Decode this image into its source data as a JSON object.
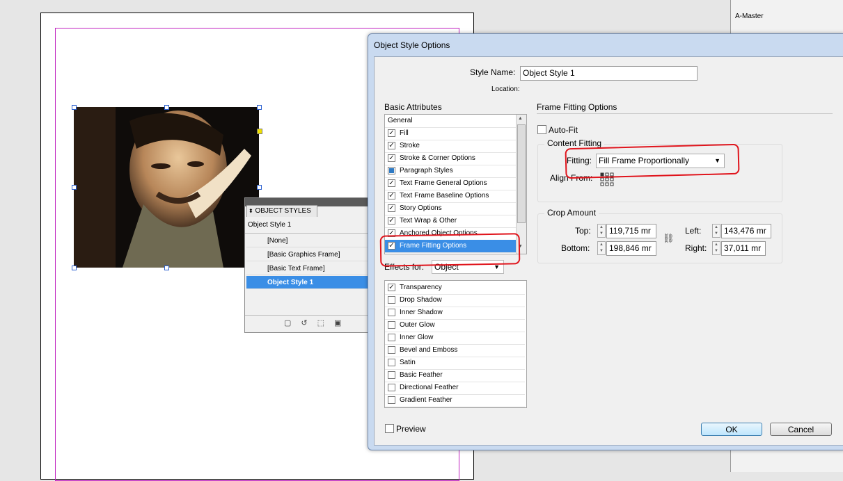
{
  "right_panel": {
    "master": "A-Master"
  },
  "object_styles_panel": {
    "tab_label": "OBJECT STYLES",
    "current_style": "Object Style 1",
    "items": [
      "[None]",
      "[Basic Graphics Frame]",
      "[Basic Text Frame]",
      "Object Style 1"
    ]
  },
  "dialog": {
    "title": "Object Style Options",
    "style_name_label": "Style Name:",
    "style_name_value": "Object Style 1",
    "location_label": "Location:",
    "basic_attributes_label": "Basic Attributes",
    "basic_attributes": [
      {
        "label": "General",
        "checked": null
      },
      {
        "label": "Fill",
        "checked": true
      },
      {
        "label": "Stroke",
        "checked": true
      },
      {
        "label": "Stroke & Corner Options",
        "checked": true
      },
      {
        "label": "Paragraph Styles",
        "checked": "partial"
      },
      {
        "label": "Text Frame General Options",
        "checked": true
      },
      {
        "label": "Text Frame Baseline Options",
        "checked": true
      },
      {
        "label": "Story Options",
        "checked": true
      },
      {
        "label": "Text Wrap & Other",
        "checked": true
      },
      {
        "label": "Anchored Object Options",
        "checked": true
      },
      {
        "label": "Frame Fitting Options",
        "checked": true,
        "selected": true
      }
    ],
    "effects_for_label": "Effects for:",
    "effects_for_value": "Object",
    "effects": [
      {
        "label": "Transparency",
        "checked": true
      },
      {
        "label": "Drop Shadow",
        "checked": false
      },
      {
        "label": "Inner Shadow",
        "checked": false
      },
      {
        "label": "Outer Glow",
        "checked": false
      },
      {
        "label": "Inner Glow",
        "checked": false
      },
      {
        "label": "Bevel and Emboss",
        "checked": false
      },
      {
        "label": "Satin",
        "checked": false
      },
      {
        "label": "Basic Feather",
        "checked": false
      },
      {
        "label": "Directional Feather",
        "checked": false
      },
      {
        "label": "Gradient Feather",
        "checked": false
      }
    ],
    "section_title": "Frame Fitting Options",
    "auto_fit_label": "Auto-Fit",
    "content_fitting_label": "Content Fitting",
    "fitting_label": "Fitting:",
    "fitting_value": "Fill Frame Proportionally",
    "align_from_label": "Align From:",
    "crop_amount_label": "Crop Amount",
    "crop": {
      "top_label": "Top:",
      "top_value": "119,715 mr",
      "bottom_label": "Bottom:",
      "bottom_value": "198,846 mr",
      "left_label": "Left:",
      "left_value": "143,476 mr",
      "right_label": "Right:",
      "right_value": "37,011 mr"
    },
    "preview_label": "Preview",
    "ok_label": "OK",
    "cancel_label": "Cancel"
  },
  "colors": {
    "selection": "#3a8ee6",
    "annotation": "#e0141c",
    "margin_guide": "#c020c0"
  }
}
